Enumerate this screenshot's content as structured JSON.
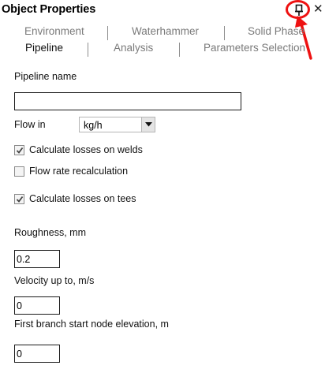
{
  "window": {
    "title": "Object Properties",
    "pin_icon": "pin-icon",
    "close_glyph": "✕",
    "annotation_color": "#e11111"
  },
  "tabs": {
    "row1": [
      {
        "label": "Environment",
        "active": false
      },
      {
        "label": "Waterhammer",
        "active": false
      },
      {
        "label": "Solid Phase",
        "active": false
      }
    ],
    "row2": [
      {
        "label": "Pipeline",
        "active": true
      },
      {
        "label": "Analysis",
        "active": false
      },
      {
        "label": "Parameters Selection",
        "active": false
      }
    ]
  },
  "form": {
    "pipeline_name_label": "Pipeline name",
    "pipeline_name_value": "",
    "flow_in_label": "Flow in",
    "flow_in_value": "kg/h",
    "checkboxes": [
      {
        "label": "Calculate losses on welds",
        "checked": true
      },
      {
        "label": "Flow rate recalculation",
        "checked": false
      },
      {
        "label": "Calculate losses on tees",
        "checked": true
      }
    ],
    "roughness_label": "Roughness, mm",
    "roughness_value": "0.2",
    "velocity_label": "Velocity up to, m/s",
    "velocity_value": "0",
    "elevation_label": "First branch start node elevation, m",
    "elevation_value": "0"
  }
}
